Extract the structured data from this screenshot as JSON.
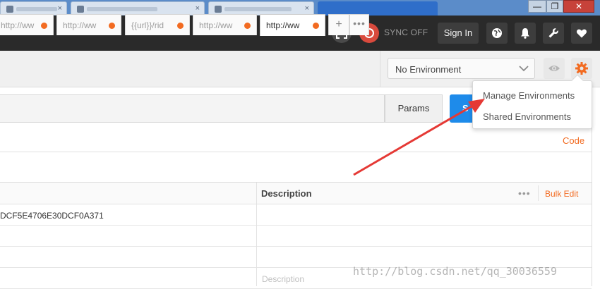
{
  "window": {
    "minimize_glyph": "—",
    "maximize_glyph": "❐",
    "close_glyph": "✕"
  },
  "topbar": {
    "sync_label": "SYNC OFF",
    "signin_label": "Sign In",
    "icons": [
      "interceptor-icon",
      "sync-icon",
      "globe-icon",
      "bell-icon",
      "wrench-icon",
      "heart-icon"
    ]
  },
  "request_tabs": {
    "tabs": [
      {
        "label": "http://ww"
      },
      {
        "label": "http://ww"
      },
      {
        "label": "{{url}}/rid"
      },
      {
        "label": "http://ww"
      },
      {
        "label": "http://ww",
        "active": true
      }
    ],
    "new_tab_label": "+",
    "more_label": "•••",
    "unsaved_dot_color": "#f26b21"
  },
  "environment": {
    "selected": "No Environment",
    "menu": {
      "items": [
        "Manage Environments",
        "Shared Environments"
      ]
    }
  },
  "request": {
    "params_label": "Params",
    "send_label": "S",
    "code_link": "Code"
  },
  "params_table": {
    "headers": {
      "description": "Description"
    },
    "more_label": "•••",
    "bulk_edit_label": "Bulk Edit",
    "rows": [
      {
        "value": "DCF5E4706E30DCF0A371"
      }
    ],
    "description_placeholder": "Description"
  },
  "watermark": "http://blog.csdn.net/qq_30036559",
  "colors": {
    "accent": "#f26b21",
    "send_button": "#1e8bea",
    "topbar": "#2a2a2a",
    "annotation_arrow": "#e53935"
  }
}
